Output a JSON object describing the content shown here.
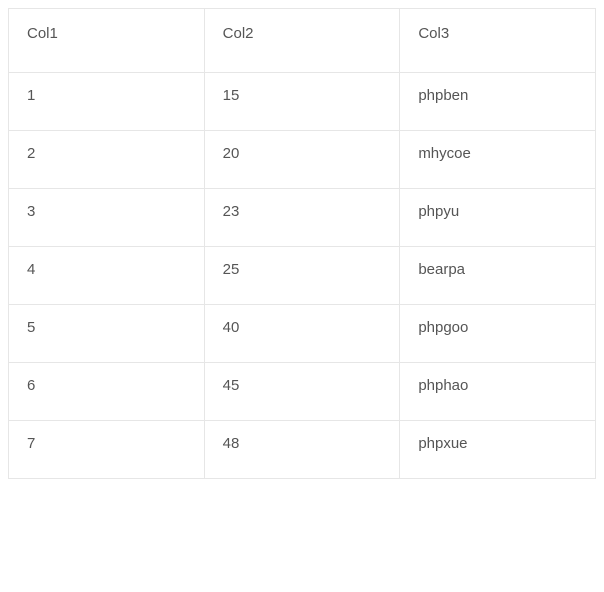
{
  "table": {
    "headers": [
      "Col1",
      "Col2",
      "Col3"
    ],
    "rows": [
      [
        "1",
        "15",
        "phpben"
      ],
      [
        "2",
        "20",
        "mhycoe"
      ],
      [
        "3",
        "23",
        "phpyu"
      ],
      [
        "4",
        "25",
        "bearpa"
      ],
      [
        "5",
        "40",
        "phpgoo"
      ],
      [
        "6",
        "45",
        "phphao"
      ],
      [
        "7",
        "48",
        "phpxue"
      ]
    ]
  }
}
